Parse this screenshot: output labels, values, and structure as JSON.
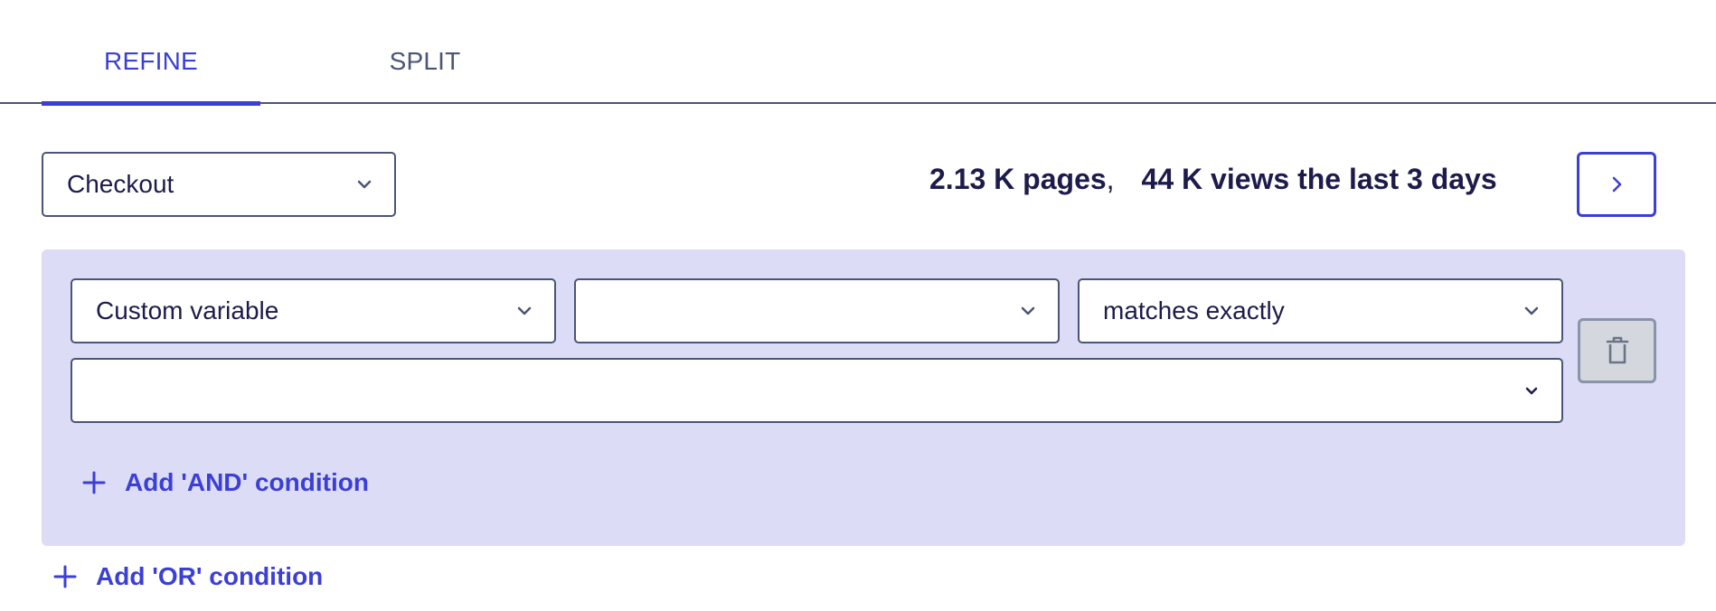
{
  "tabs": [
    {
      "label": "REFINE",
      "active": true
    },
    {
      "label": "SPLIT",
      "active": false
    }
  ],
  "page_select": {
    "value": "Checkout"
  },
  "stats": {
    "pages": "2.13 K pages",
    "separator": ",",
    "views": "44 K views the last 3 days"
  },
  "condition": {
    "variable_select": {
      "value": "Custom variable"
    },
    "name_select": {
      "value": ""
    },
    "operator_select": {
      "value": "matches exactly"
    },
    "value_select": {
      "value": ""
    }
  },
  "actions": {
    "add_and": "Add 'AND' condition",
    "add_or": "Add 'OR' condition"
  },
  "colors": {
    "accent": "#3b3fd6",
    "panel_bg": "#dcdcf7",
    "text": "#1d1b4b",
    "border": "#4a5577"
  },
  "icons": {
    "dropdown": "chevron-down-icon",
    "next": "chevron-right-icon",
    "delete": "trash-icon",
    "add": "plus-icon"
  }
}
